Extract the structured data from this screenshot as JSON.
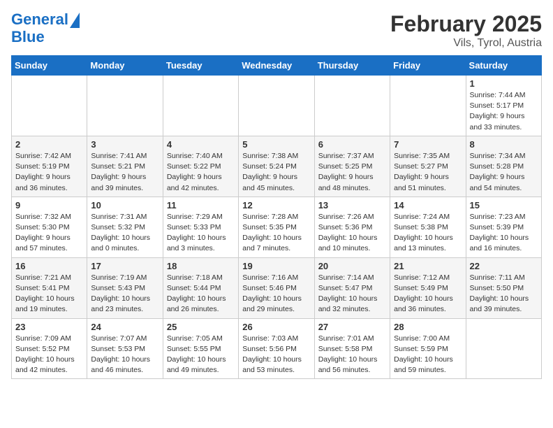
{
  "logo": {
    "line1": "General",
    "line2": "Blue"
  },
  "title": "February 2025",
  "subtitle": "Vils, Tyrol, Austria",
  "weekdays": [
    "Sunday",
    "Monday",
    "Tuesday",
    "Wednesday",
    "Thursday",
    "Friday",
    "Saturday"
  ],
  "weeks": [
    [
      {
        "day": "",
        "info": ""
      },
      {
        "day": "",
        "info": ""
      },
      {
        "day": "",
        "info": ""
      },
      {
        "day": "",
        "info": ""
      },
      {
        "day": "",
        "info": ""
      },
      {
        "day": "",
        "info": ""
      },
      {
        "day": "1",
        "info": "Sunrise: 7:44 AM\nSunset: 5:17 PM\nDaylight: 9 hours and 33 minutes."
      }
    ],
    [
      {
        "day": "2",
        "info": "Sunrise: 7:42 AM\nSunset: 5:19 PM\nDaylight: 9 hours and 36 minutes."
      },
      {
        "day": "3",
        "info": "Sunrise: 7:41 AM\nSunset: 5:21 PM\nDaylight: 9 hours and 39 minutes."
      },
      {
        "day": "4",
        "info": "Sunrise: 7:40 AM\nSunset: 5:22 PM\nDaylight: 9 hours and 42 minutes."
      },
      {
        "day": "5",
        "info": "Sunrise: 7:38 AM\nSunset: 5:24 PM\nDaylight: 9 hours and 45 minutes."
      },
      {
        "day": "6",
        "info": "Sunrise: 7:37 AM\nSunset: 5:25 PM\nDaylight: 9 hours and 48 minutes."
      },
      {
        "day": "7",
        "info": "Sunrise: 7:35 AM\nSunset: 5:27 PM\nDaylight: 9 hours and 51 minutes."
      },
      {
        "day": "8",
        "info": "Sunrise: 7:34 AM\nSunset: 5:28 PM\nDaylight: 9 hours and 54 minutes."
      }
    ],
    [
      {
        "day": "9",
        "info": "Sunrise: 7:32 AM\nSunset: 5:30 PM\nDaylight: 9 hours and 57 minutes."
      },
      {
        "day": "10",
        "info": "Sunrise: 7:31 AM\nSunset: 5:32 PM\nDaylight: 10 hours and 0 minutes."
      },
      {
        "day": "11",
        "info": "Sunrise: 7:29 AM\nSunset: 5:33 PM\nDaylight: 10 hours and 3 minutes."
      },
      {
        "day": "12",
        "info": "Sunrise: 7:28 AM\nSunset: 5:35 PM\nDaylight: 10 hours and 7 minutes."
      },
      {
        "day": "13",
        "info": "Sunrise: 7:26 AM\nSunset: 5:36 PM\nDaylight: 10 hours and 10 minutes."
      },
      {
        "day": "14",
        "info": "Sunrise: 7:24 AM\nSunset: 5:38 PM\nDaylight: 10 hours and 13 minutes."
      },
      {
        "day": "15",
        "info": "Sunrise: 7:23 AM\nSunset: 5:39 PM\nDaylight: 10 hours and 16 minutes."
      }
    ],
    [
      {
        "day": "16",
        "info": "Sunrise: 7:21 AM\nSunset: 5:41 PM\nDaylight: 10 hours and 19 minutes."
      },
      {
        "day": "17",
        "info": "Sunrise: 7:19 AM\nSunset: 5:43 PM\nDaylight: 10 hours and 23 minutes."
      },
      {
        "day": "18",
        "info": "Sunrise: 7:18 AM\nSunset: 5:44 PM\nDaylight: 10 hours and 26 minutes."
      },
      {
        "day": "19",
        "info": "Sunrise: 7:16 AM\nSunset: 5:46 PM\nDaylight: 10 hours and 29 minutes."
      },
      {
        "day": "20",
        "info": "Sunrise: 7:14 AM\nSunset: 5:47 PM\nDaylight: 10 hours and 32 minutes."
      },
      {
        "day": "21",
        "info": "Sunrise: 7:12 AM\nSunset: 5:49 PM\nDaylight: 10 hours and 36 minutes."
      },
      {
        "day": "22",
        "info": "Sunrise: 7:11 AM\nSunset: 5:50 PM\nDaylight: 10 hours and 39 minutes."
      }
    ],
    [
      {
        "day": "23",
        "info": "Sunrise: 7:09 AM\nSunset: 5:52 PM\nDaylight: 10 hours and 42 minutes."
      },
      {
        "day": "24",
        "info": "Sunrise: 7:07 AM\nSunset: 5:53 PM\nDaylight: 10 hours and 46 minutes."
      },
      {
        "day": "25",
        "info": "Sunrise: 7:05 AM\nSunset: 5:55 PM\nDaylight: 10 hours and 49 minutes."
      },
      {
        "day": "26",
        "info": "Sunrise: 7:03 AM\nSunset: 5:56 PM\nDaylight: 10 hours and 53 minutes."
      },
      {
        "day": "27",
        "info": "Sunrise: 7:01 AM\nSunset: 5:58 PM\nDaylight: 10 hours and 56 minutes."
      },
      {
        "day": "28",
        "info": "Sunrise: 7:00 AM\nSunset: 5:59 PM\nDaylight: 10 hours and 59 minutes."
      },
      {
        "day": "",
        "info": ""
      }
    ]
  ]
}
